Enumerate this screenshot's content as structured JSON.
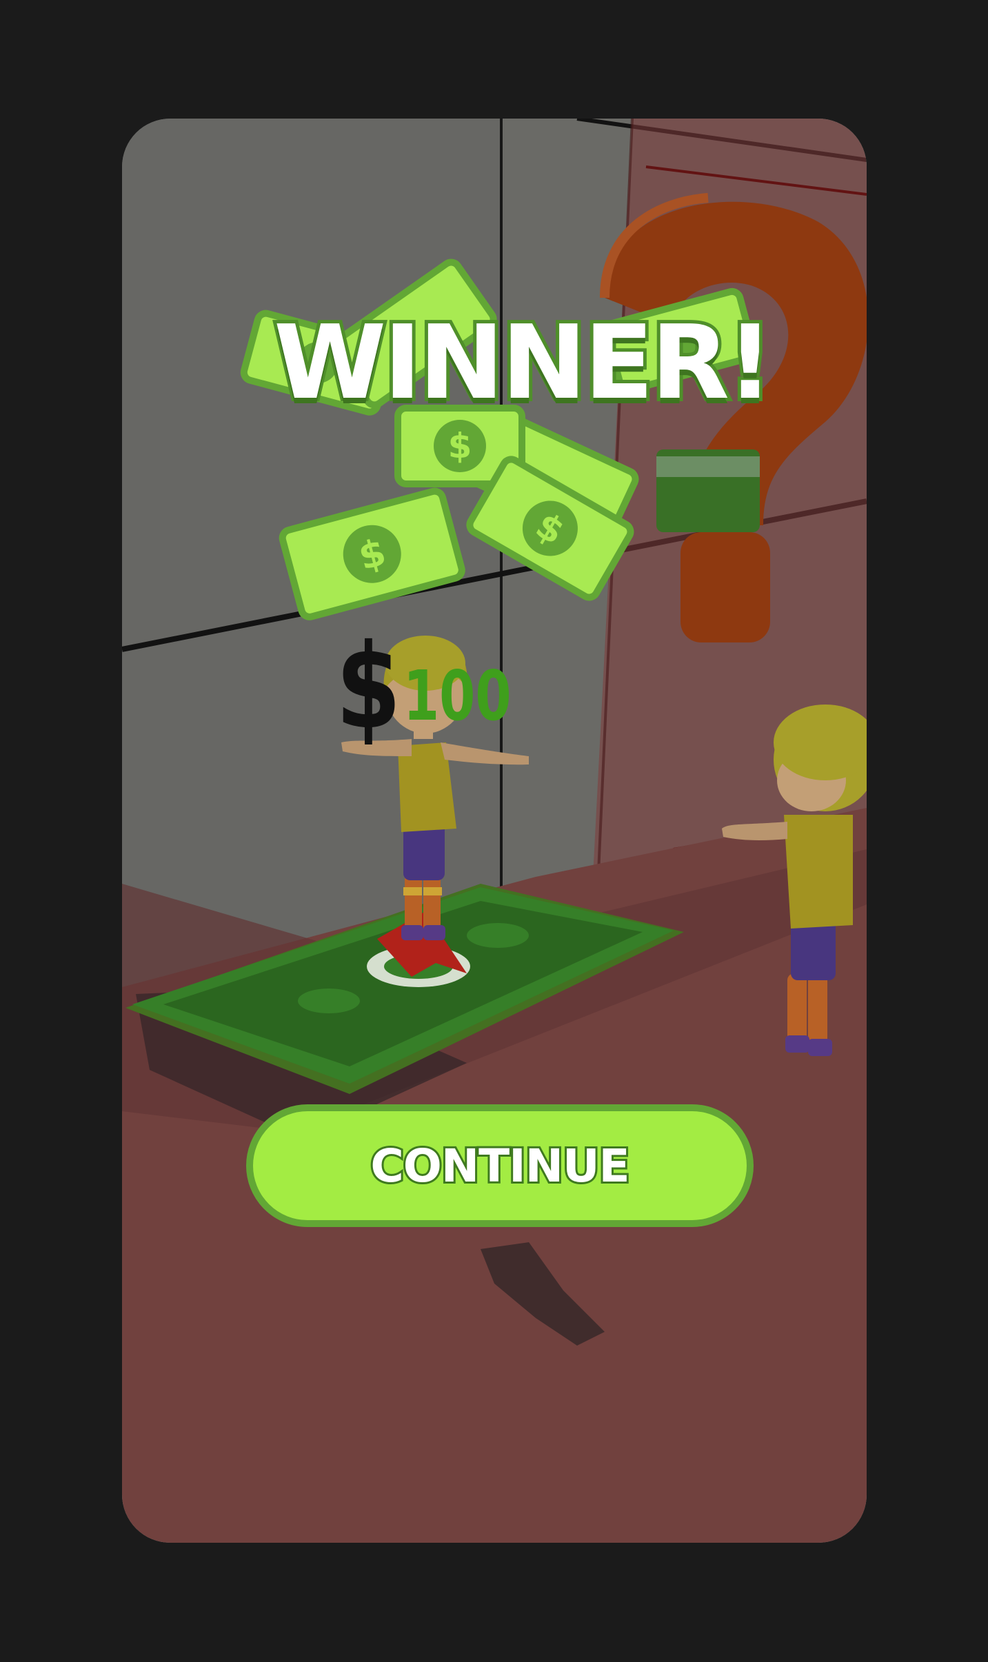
{
  "popup": {
    "title": "WINNER!",
    "reward_currency": "$",
    "reward_amount": "100",
    "continue_label": "CONTINUE"
  },
  "colors": {
    "accent_green": "#a3ec43",
    "button_border": "#62a735",
    "amount_green": "#3f9f1c",
    "floor_red": "#7b4744",
    "wall_grey": "#6f6f6c",
    "page_background": "#1b1b1b"
  },
  "icons": [
    "money-bill-icon",
    "question-mark-icon",
    "dollar-icon"
  ]
}
